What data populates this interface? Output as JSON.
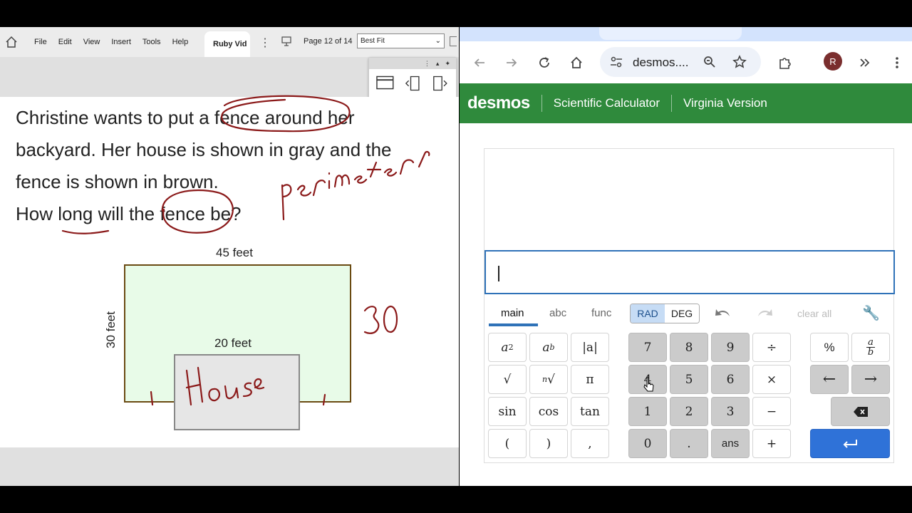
{
  "viewer": {
    "menu": [
      "File",
      "Edit",
      "View",
      "Insert",
      "Tools",
      "Help"
    ],
    "tab_title": "Ruby Vid",
    "page_label": "Page 12 of 14",
    "fit_value": "Best Fit"
  },
  "problem": {
    "line1": "Christine wants to put a fence around her",
    "line2": "backyard. Her house is shown in gray and the",
    "line3": "fence is shown in brown.",
    "line4": "How long will the fence be?"
  },
  "diagram": {
    "top_label": "45 feet",
    "side_label": "30 feet",
    "house_label": "20 feet"
  },
  "browser": {
    "address": "desmos....",
    "avatar_letter": "R"
  },
  "desmos": {
    "brand": "desmos",
    "nav1": "Scientific Calculator",
    "nav2": "Virginia Version",
    "tabs": [
      "main",
      "abc",
      "func"
    ],
    "mode_rad": "RAD",
    "mode_deg": "DEG",
    "clear_all": "clear all",
    "keys": {
      "abs": "|a|",
      "pi": "π",
      "sqrt": "√",
      "nthroot": "√",
      "sin": "sin",
      "cos": "cos",
      "tan": "tan",
      "lparen": "(",
      "rparen": ")",
      "comma": ",",
      "k7": "7",
      "k8": "8",
      "k9": "9",
      "div": "÷",
      "k4": "4",
      "k5": "5",
      "k6": "6",
      "mul": "×",
      "k1": "1",
      "k2": "2",
      "k3": "3",
      "minus": "−",
      "k0": "0",
      "dot": ".",
      "ans": "ans",
      "plus": "+",
      "percent": "%",
      "left": "←",
      "right": "→"
    }
  },
  "colors": {
    "desmos_green": "#2f8a3c",
    "input_border": "#2f72b8",
    "ink": "#8b1a1a",
    "fence": "#6a4a12"
  }
}
